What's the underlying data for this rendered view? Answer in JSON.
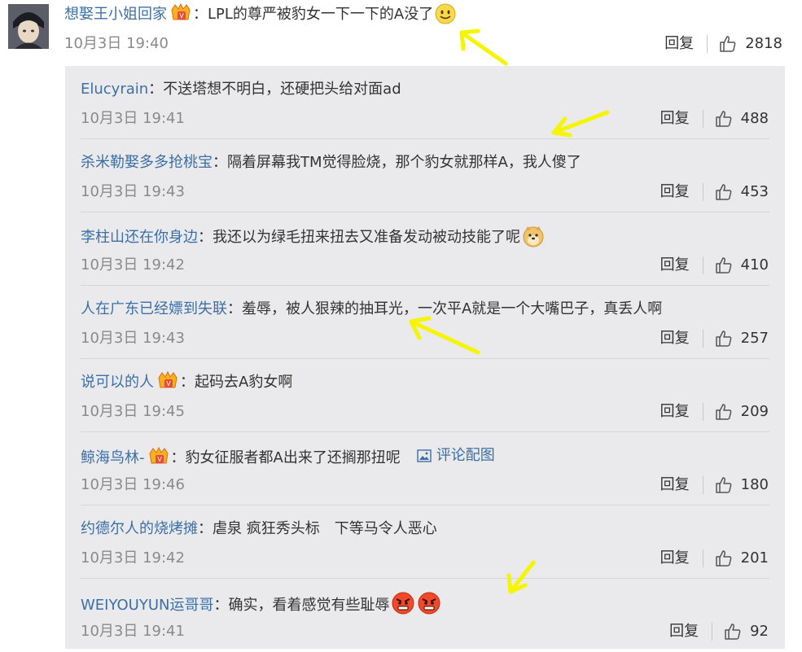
{
  "main_comment": {
    "username": "想娶王小姐回家",
    "sep": "：",
    "text": "LPL的尊严被豹女一下一下的A没了",
    "time": "10月3日 19:40",
    "reply_label": "回复",
    "likes": "2818"
  },
  "replies": [
    {
      "username": "Elucyrain",
      "sep": "：",
      "text": "不送塔想不明白，还硬把头给对面ad",
      "time": "10月3日 19:41",
      "reply_label": "回复",
      "likes": "488"
    },
    {
      "username": "杀米勒娶多多抢桃宝",
      "sep": "：",
      "text": "隔着屏幕我TM觉得脸烧，那个豹女就那样A，我人傻了",
      "time": "10月3日 19:43",
      "reply_label": "回复",
      "likes": "453"
    },
    {
      "username": "李柱山还在你身边",
      "sep": "：",
      "text": "我还以为绿毛扭来扭去又准备发动被动技能了呢",
      "time": "10月3日 19:42",
      "reply_label": "回复",
      "likes": "410"
    },
    {
      "username": "人在广东已经嫖到失联",
      "sep": "：",
      "text": "羞辱，被人狠辣的抽耳光，一次平A就是一个大嘴巴子，真丢人啊",
      "time": "10月3日 19:43",
      "reply_label": "回复",
      "likes": "257"
    },
    {
      "username": "说可以的人",
      "sep": "：",
      "text": "起码去A豹女啊",
      "time": "10月3日 19:45",
      "reply_label": "回复",
      "likes": "209"
    },
    {
      "username": "鲸海鸟林-",
      "sep": "：",
      "text": "豹女征服者都A出来了还搁那扭呢",
      "pic_link": "评论配图",
      "time": "10月3日 19:46",
      "reply_label": "回复",
      "likes": "180"
    },
    {
      "username": "约德尔人的烧烤摊",
      "sep": "：",
      "text": "虐泉 疯狂秀头标　下等马令人恶心",
      "time": "10月3日 19:42",
      "reply_label": "回复",
      "likes": "201"
    },
    {
      "username": "WEIYOUYUN运哥哥",
      "sep": "：",
      "text": "确实，看着感觉有些耻辱",
      "time": "10月3日 19:41",
      "reply_label": "回复",
      "likes": "92"
    }
  ],
  "colors": {
    "username": "#3c6fa6",
    "time": "#8a8a8a",
    "reply_bg": "#eaeaec",
    "annotation_arrow": "#f5f500"
  },
  "icons": {
    "like": "thumbs-up-icon",
    "badge": "vip-crown-badge-icon",
    "image": "image-icon"
  }
}
